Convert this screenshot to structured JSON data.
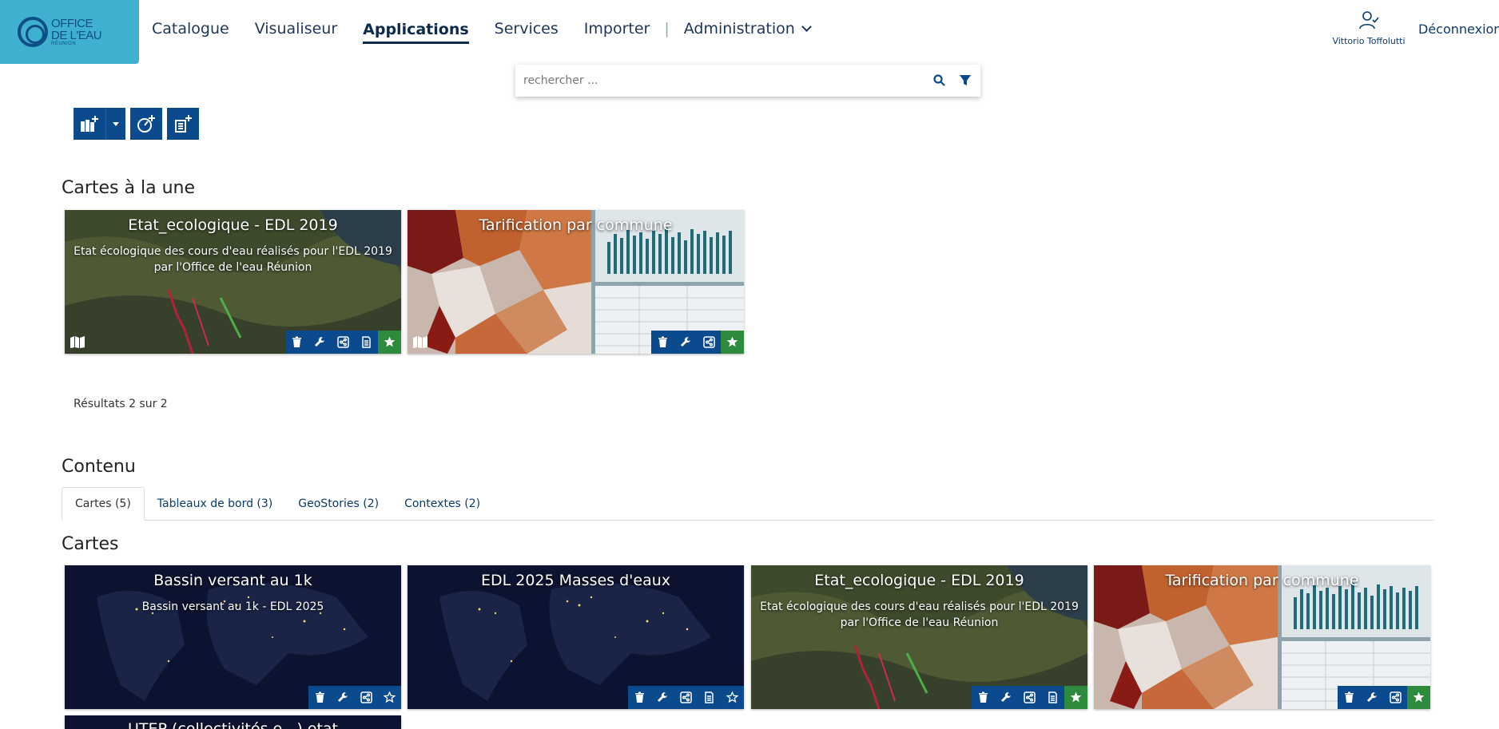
{
  "logo": {
    "line1": "OFFICE",
    "line2": "DE L'EAU",
    "line3": "RÉUNION"
  },
  "nav": {
    "items": [
      "Catalogue",
      "Visualiseur",
      "Applications",
      "Services",
      "Importer"
    ],
    "separator": "|",
    "admin": "Administration"
  },
  "user": {
    "name": "Vittorio Toffolutti",
    "logout": "Déconnexion"
  },
  "search": {
    "placeholder": "rechercher ..."
  },
  "featured": {
    "heading": "Cartes à la une",
    "cards": [
      {
        "title": "Etat_ecologique - EDL 2019",
        "desc": "Etat écologique des cours d'eau réalisés pour l'EDL 2019 par l'Office de l'eau Réunion"
      },
      {
        "title": "Tarification par commune",
        "desc": ""
      }
    ],
    "results": "Résultats 2 sur 2"
  },
  "content": {
    "heading": "Contenu",
    "tabs": [
      "Cartes (5)",
      "Tableaux de bord (3)",
      "GeoStories (2)",
      "Contextes (2)"
    ],
    "sub_heading": "Cartes",
    "cards": [
      {
        "title": "Bassin versant au 1k",
        "desc": "Bassin versant au 1k - EDL 2025"
      },
      {
        "title": "EDL 2025 Masses d'eaux",
        "desc": ""
      },
      {
        "title": "Etat_ecologique - EDL 2019",
        "desc": "Etat écologique des cours d'eau réalisés pour l'EDL 2019 par l'Office de l'eau Réunion"
      },
      {
        "title": "Tarification par commune",
        "desc": ""
      },
      {
        "title": "UTEP (collectivités e...) etat",
        "desc": ""
      }
    ]
  },
  "colors": {
    "primary": "#0b4a8c",
    "favorite": "#2e8b3d",
    "logo_bg": "#3fb0cf"
  }
}
